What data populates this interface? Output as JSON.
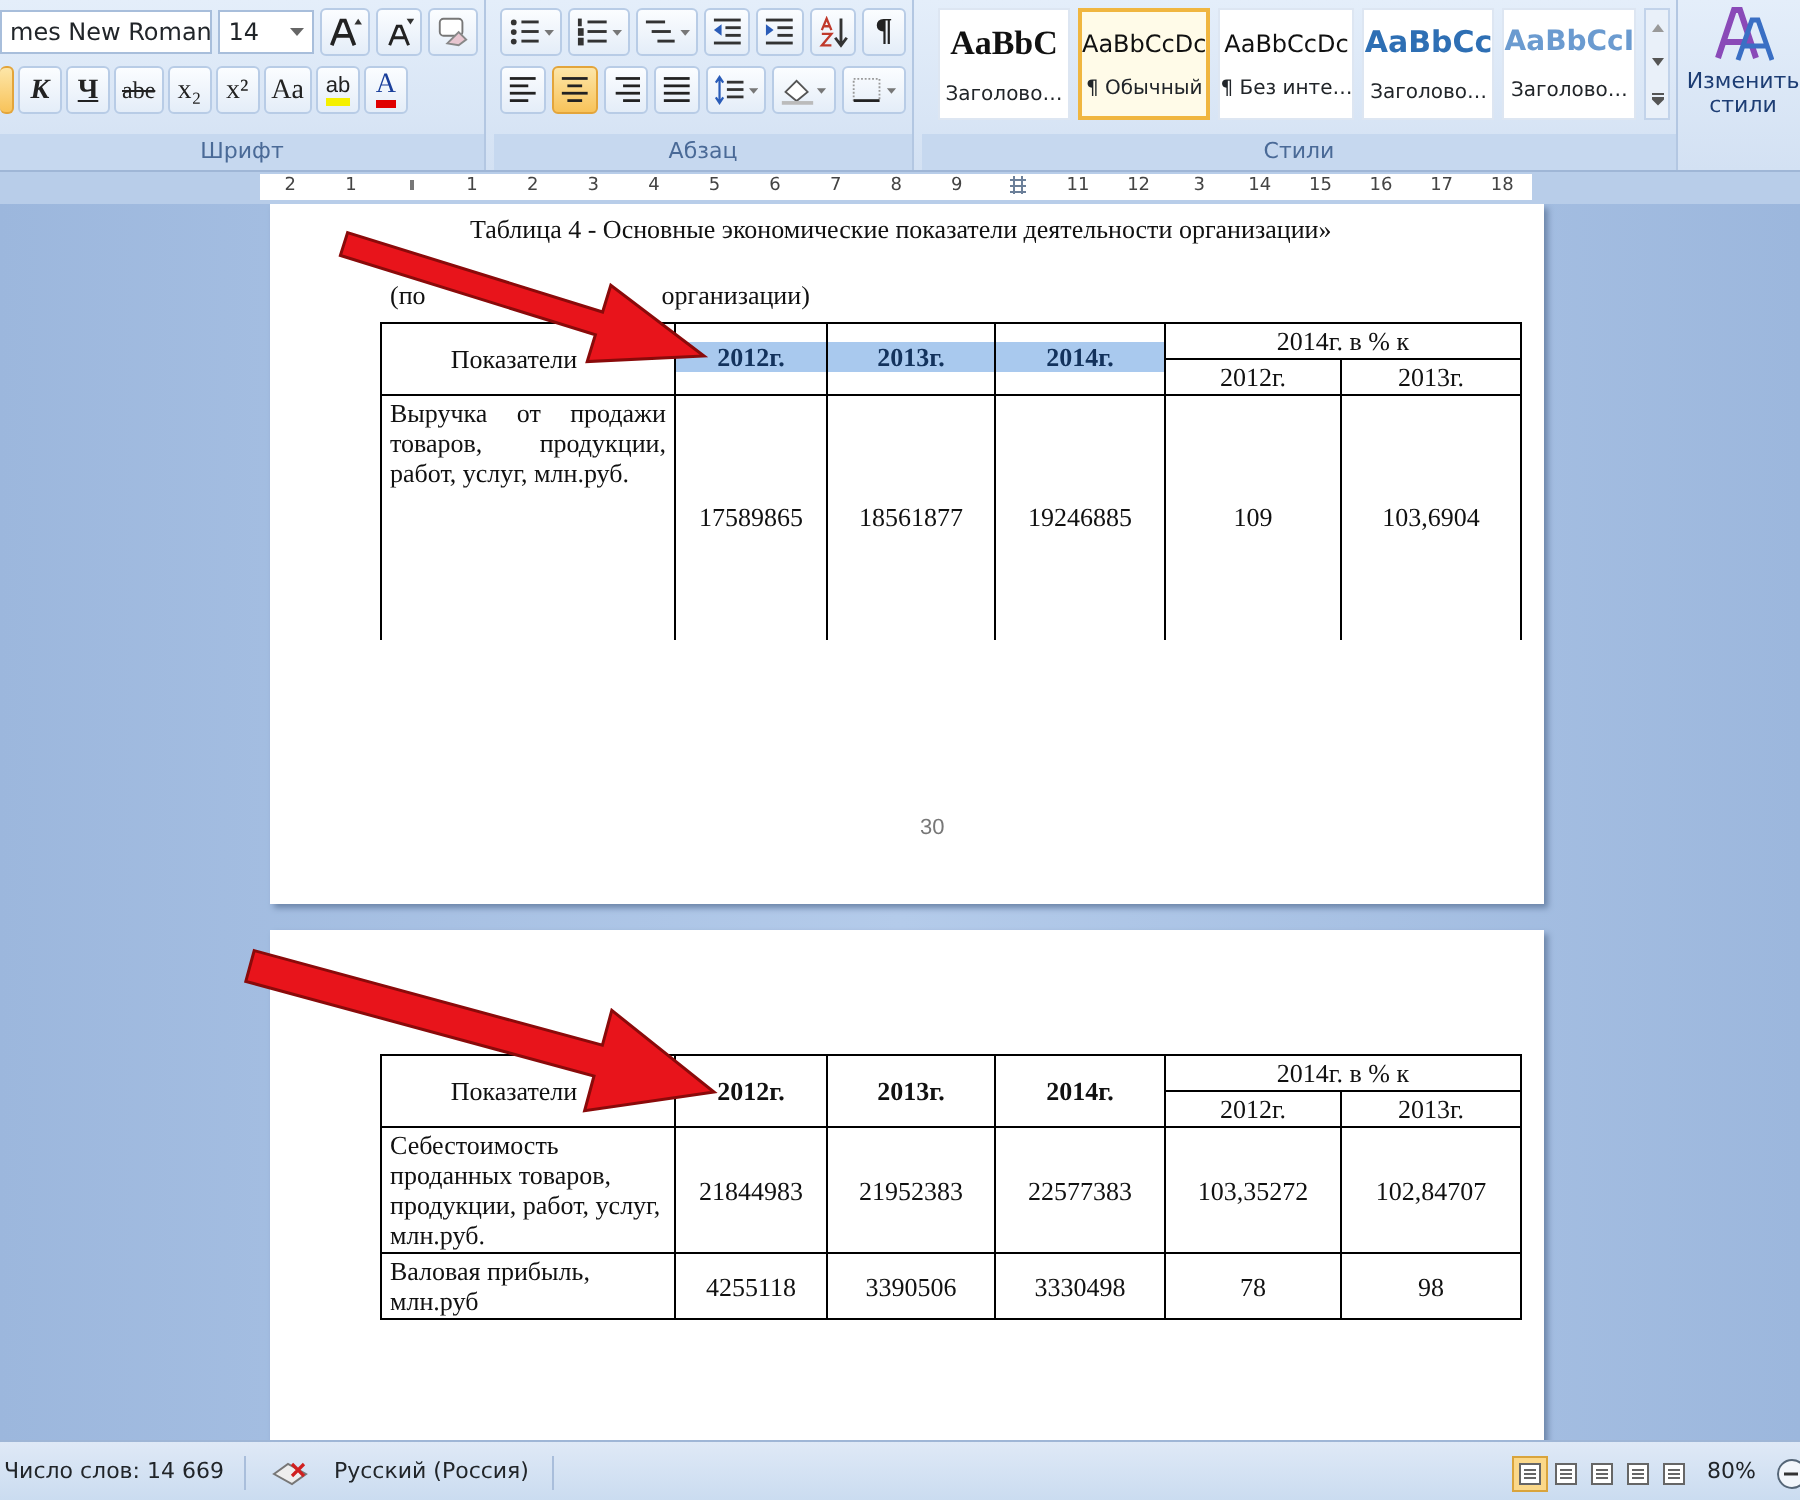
{
  "ribbon": {
    "font_group": {
      "label": "Шрифт",
      "font_name": "mes New Roman",
      "font_size": "14",
      "buttons": [
        {
          "kind": "bold",
          "selected": true
        },
        {
          "kind": "italic",
          "label": "К",
          "selected": false
        },
        {
          "kind": "underline",
          "label": "Ч",
          "selected": false
        },
        {
          "kind": "strike",
          "label": "abe",
          "selected": false
        },
        {
          "kind": "sub",
          "label": "x₂",
          "selected": false
        },
        {
          "kind": "sup",
          "label": "x²",
          "selected": false
        },
        {
          "kind": "case",
          "label": "Aa",
          "selected": false
        },
        {
          "kind": "highlight",
          "label": "ab",
          "selected": false
        },
        {
          "kind": "color",
          "label": "A",
          "selected": false
        }
      ]
    },
    "paragraph_group": {
      "label": "Абзац",
      "pilcrow": "¶",
      "alignment": [
        {
          "kind": "left",
          "selected": false
        },
        {
          "kind": "center",
          "selected": true
        },
        {
          "kind": "right",
          "selected": false
        },
        {
          "kind": "justify",
          "selected": false
        }
      ]
    },
    "styles_group": {
      "label": "Стили",
      "styles": [
        {
          "kind": "title",
          "sample": "AaBbC",
          "name": "Заголово…",
          "selected": false
        },
        {
          "kind": "normal",
          "sample": "AaBbCcDc",
          "name": "¶ Обычный",
          "selected": true
        },
        {
          "kind": "normal",
          "sample": "AaBbCcDc",
          "name": "¶ Без инте…",
          "selected": false
        },
        {
          "kind": "heading1",
          "sample": "AaBbCc",
          "name": "Заголово…",
          "selected": false
        },
        {
          "kind": "heading2",
          "sample": "AaBbCcI",
          "name": "Заголово…",
          "selected": false
        }
      ]
    },
    "change_styles": {
      "label": "Изменить стили"
    }
  },
  "ruler": [
    {
      "kind": "number",
      "label": "2"
    },
    {
      "kind": "number",
      "label": "1"
    },
    {
      "kind": "tick"
    },
    {
      "kind": "number",
      "label": "1"
    },
    {
      "kind": "number",
      "label": "2"
    },
    {
      "kind": "number",
      "label": "3"
    },
    {
      "kind": "number",
      "label": "4"
    },
    {
      "kind": "number",
      "label": "5"
    },
    {
      "kind": "number",
      "label": "6"
    },
    {
      "kind": "number",
      "label": "7"
    },
    {
      "kind": "number",
      "label": "8"
    },
    {
      "kind": "number",
      "label": "9"
    },
    {
      "kind": "marker"
    },
    {
      "kind": "number",
      "label": "11"
    },
    {
      "kind": "number",
      "label": "12"
    },
    {
      "kind": "number",
      "label": "3"
    },
    {
      "kind": "number",
      "label": "14"
    },
    {
      "kind": "number",
      "label": "15"
    },
    {
      "kind": "number",
      "label": "16"
    },
    {
      "kind": "number",
      "label": "17"
    },
    {
      "kind": "number",
      "label": "18"
    }
  ],
  "pages": [
    {
      "caption": "Таблица 4 - Основные экономические показатели деятельности организации»",
      "source_parts": [
        "(по",
        "организации)"
      ],
      "page_number": "30",
      "continues": true,
      "table": {
        "head": "Показатели",
        "years": [
          {
            "label": "2012г.",
            "highlighted": true
          },
          {
            "label": "2013г.",
            "highlighted": true
          },
          {
            "label": "2014г.",
            "highlighted": true
          }
        ],
        "percent_head": "2014г. в % к",
        "percent_cols": [
          "2012г.",
          "2013г."
        ],
        "rows": [
          {
            "cells": [
              "Выручка от продажи товаров, продукции, работ, услуг, млн.руб.",
              "17589865",
              "18561877",
              "19246885",
              "109",
              "103,6904"
            ]
          }
        ]
      }
    },
    {
      "table": {
        "head": "Показатели",
        "years": [
          {
            "label": "2012г.",
            "highlighted": false
          },
          {
            "label": "2013г.",
            "highlighted": false
          },
          {
            "label": "2014г.",
            "highlighted": false
          }
        ],
        "percent_head": "2014г. в % к",
        "percent_cols": [
          "2012г.",
          "2013г."
        ],
        "rows": [
          {
            "cells": [
              "Себестоимость проданных товаров, продукции, работ, услуг, млн.руб.",
              "21844983",
              "21952383",
              "22577383",
              "103,35272",
              "102,84707"
            ]
          },
          {
            "cells": [
              "Валовая прибыль, млн.руб",
              "4255118",
              "3390506",
              "3330498",
              "78",
              "98"
            ]
          }
        ]
      }
    }
  ],
  "status_bar": {
    "word_count": "Число слов: 14 669",
    "language": "Русский (Россия)",
    "views": [
      {
        "selected": true
      },
      {
        "selected": false
      },
      {
        "selected": false
      },
      {
        "selected": false
      },
      {
        "selected": false
      }
    ],
    "zoom": "80%"
  }
}
